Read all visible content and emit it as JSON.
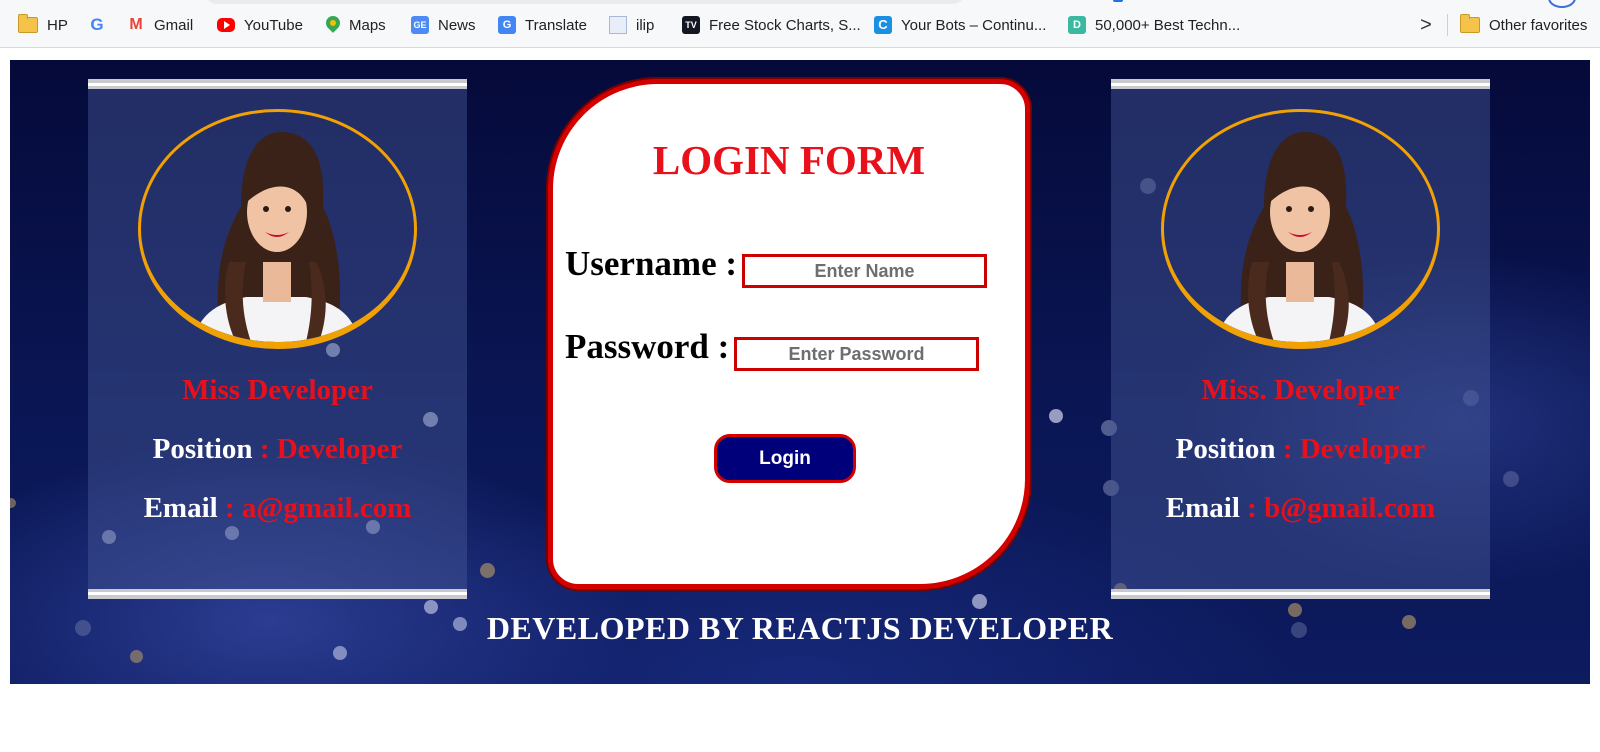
{
  "bookmarks_bar": {
    "items": [
      {
        "label": "HP",
        "icon": "folder-icon"
      },
      {
        "label": "",
        "icon": "google-icon"
      },
      {
        "label": "Gmail",
        "icon": "gmail-icon"
      },
      {
        "label": "YouTube",
        "icon": "youtube-icon"
      },
      {
        "label": "Maps",
        "icon": "maps-icon"
      },
      {
        "label": "News",
        "icon": "news-icon"
      },
      {
        "label": "Translate",
        "icon": "translate-icon"
      },
      {
        "label": "ilip",
        "icon": "document-icon"
      },
      {
        "label": "Free Stock Charts, S...",
        "icon": "tradingview-icon"
      },
      {
        "label": "Your Bots – Continu...",
        "icon": "continual-icon"
      },
      {
        "label": "50,000+ Best Techn...",
        "icon": "d-site-icon"
      }
    ],
    "more_chevron": ">",
    "other_favorites": {
      "label": "Other favorites",
      "icon": "folder-icon"
    }
  },
  "left_card": {
    "name": "Miss Developer",
    "position_label": "Position",
    "position_value": ": Developer",
    "email_label": "Email",
    "email_value": ": a@gmail.com"
  },
  "right_card": {
    "name": "Miss. Developer",
    "position_label": "Position",
    "position_value": ": Developer",
    "email_label": "Email",
    "email_value": ": b@gmail.com"
  },
  "login_form": {
    "title": "LOGIN FORM",
    "username_label": "Username :",
    "username_placeholder": "Enter Name",
    "password_label": "Password :",
    "password_placeholder": "Enter Password",
    "button_label": "Login"
  },
  "footer": {
    "text": "DEVELOPED BY REACTJS DEVELOPER"
  },
  "colors": {
    "accent_red": "#e8101a",
    "border_red": "#d40000",
    "button_navy": "#00007a",
    "ring_orange": "#f2a104",
    "background_navy": "#0a1654"
  }
}
